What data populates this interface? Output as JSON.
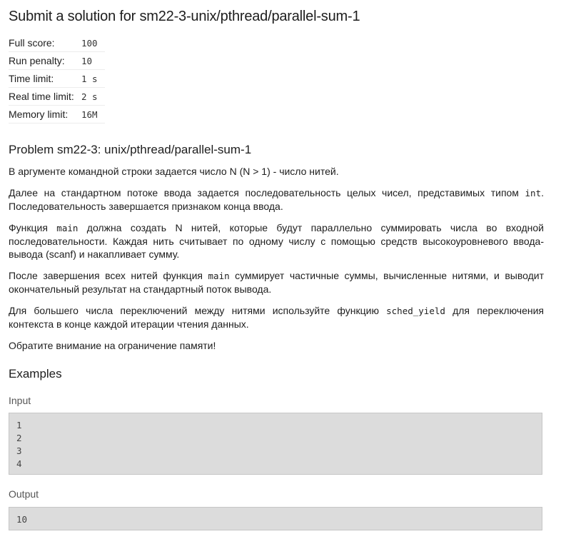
{
  "title": "Submit a solution for sm22-3-unix/pthread/parallel-sum-1",
  "info": [
    {
      "key": "Full score:",
      "value": "100"
    },
    {
      "key": "Run penalty:",
      "value": "10"
    },
    {
      "key": "Time limit:",
      "value": "1 s"
    },
    {
      "key": "Real time limit:",
      "value": "2 s"
    },
    {
      "key": "Memory limit:",
      "value": "16M"
    }
  ],
  "problem_title": "Problem sm22-3: unix/pthread/parallel-sum-1",
  "statement": {
    "p1": "В аргументе командной строки задается число N (N > 1) - число нитей.",
    "p2a": "Далее на стандартном потоке ввода задается последовательность целых чисел, представимых типом ",
    "p2code": "int",
    "p2b": ". Последовательность завершается признаком конца ввода.",
    "p3a": "Функция ",
    "p3code": "main",
    "p3b": " должна создать N нитей, которые будут параллельно суммировать числа во входной последовательности. Каждая нить считывает по одному числу с помощью средств высокоуровневого ввода-вывода (scanf) и накапливает сумму.",
    "p4a": "После завершения всех нитей функция ",
    "p4code": "main",
    "p4b": " суммирует частичные суммы, вычисленные нитями, и выводит окончательный результат на стандартный поток вывода.",
    "p5a": "Для большего числа переключений между нитями используйте функцию ",
    "p5code": "sched_yield",
    "p5b": " для переключения контекста в конце каждой итерации чтения данных.",
    "p6": "Обратите внимание на ограничение памяти!"
  },
  "examples_title": "Examples",
  "input_label": "Input",
  "input_value": "1\n2\n3\n4",
  "output_label": "Output",
  "output_value": "10"
}
